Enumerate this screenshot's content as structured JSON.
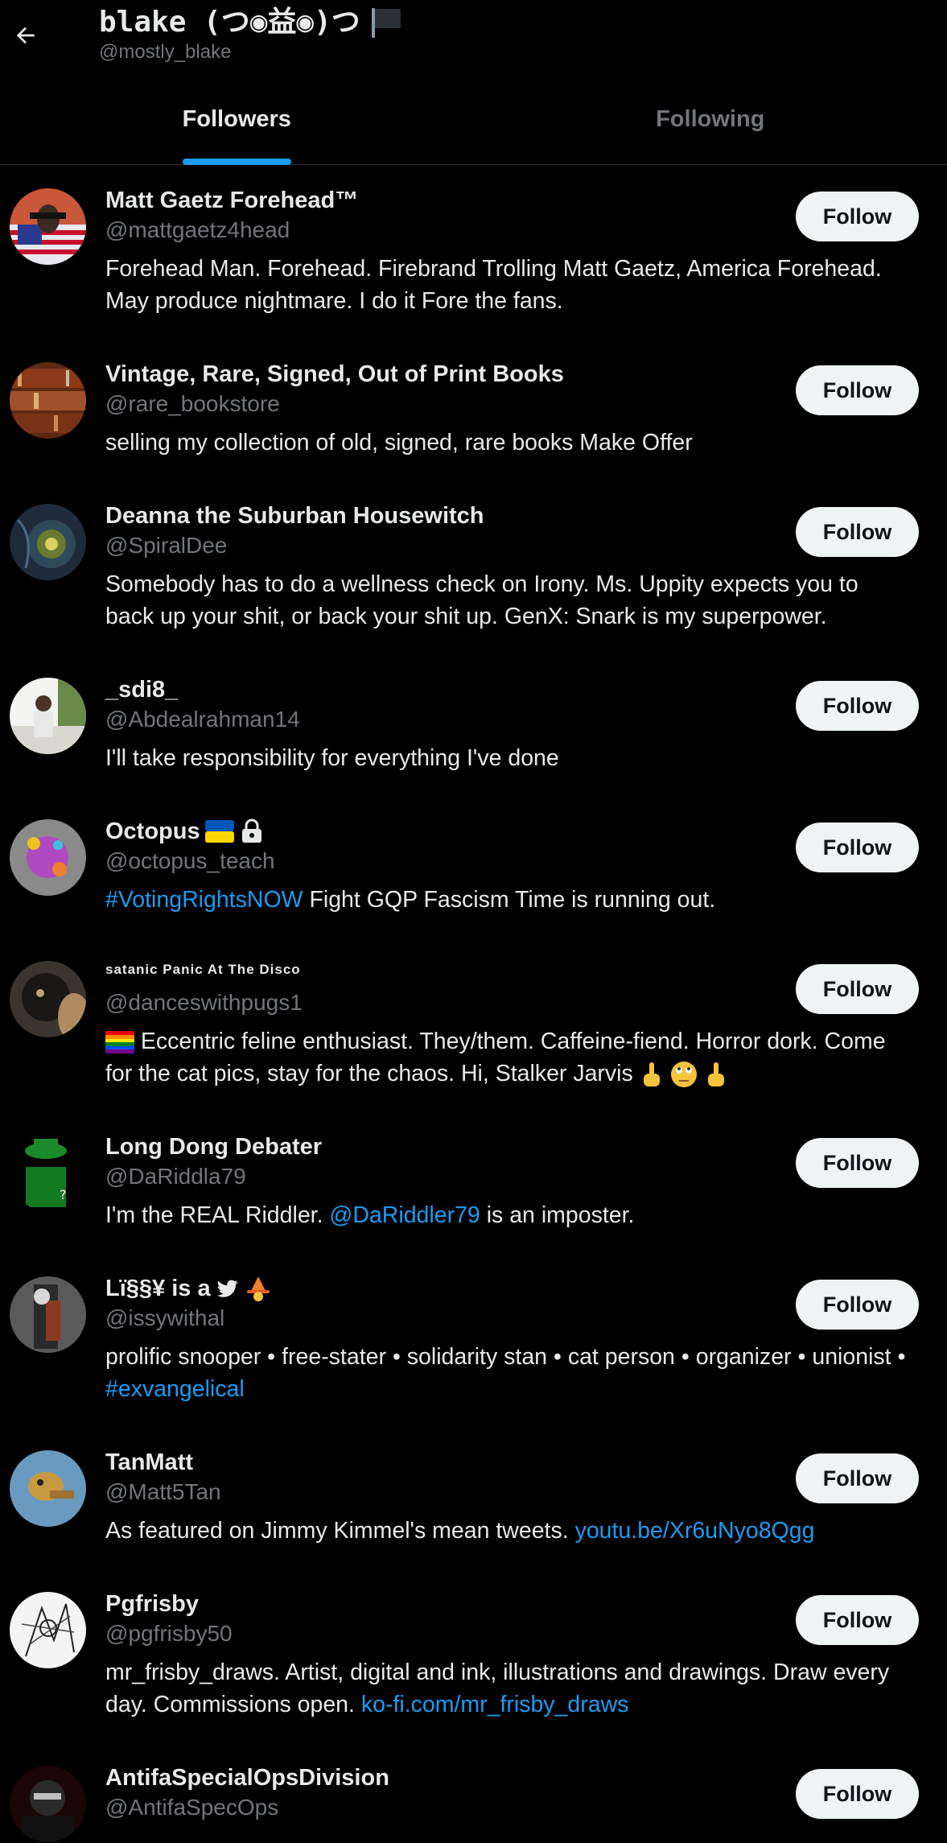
{
  "header": {
    "title": "blake (つ◉益◉)つ",
    "handle": "@mostly_blake"
  },
  "tabs": [
    {
      "label": "Followers",
      "active": true
    },
    {
      "label": "Following",
      "active": false
    }
  ],
  "follow_label": "Follow",
  "colors": {
    "background": "#000000",
    "accent": "#1d9bf0",
    "secondary_text": "#71767b",
    "button_bg": "#eff3f4"
  },
  "users": [
    {
      "name": "Matt Gaetz Forehead™",
      "handle": "@mattgaetz4head",
      "bio": [
        {
          "text": "Forehead Man. Forehead. Firebrand Trolling Matt Gaetz, America Forehead. May produce nightmare. I do it Fore the fans."
        }
      ]
    },
    {
      "name": "Vintage, Rare, Signed, Out of Print Books",
      "handle": "@rare_bookstore",
      "bio": [
        {
          "text": "selling my collection of old, signed, rare books Make Offer"
        }
      ]
    },
    {
      "name": "Deanna the Suburban Housewitch",
      "handle": "@SpiralDee",
      "bio": [
        {
          "text": "Somebody has to do a wellness check on Irony. Ms. Uppity expects you to back up your shit, or back your shit up. GenX: Snark is my superpower."
        }
      ]
    },
    {
      "name": "_sdi8_",
      "handle": "@Abdealrahman14",
      "bio": [
        {
          "text": "I'll take responsibility for everything I've done"
        }
      ]
    },
    {
      "name": "Octopus",
      "handle": "@octopus_teach",
      "bio": [
        {
          "text": "#VotingRightsNOW",
          "link": true
        },
        {
          "text": " Fight GQP Fascism Time is running out."
        }
      ]
    },
    {
      "name": "satanic Panic At The Disco",
      "handle": "@danceswithpugs1",
      "bio": [
        {
          "text": "Eccentric feline enthusiast. They/them. Caffeine-fiend. Horror dork. Come for the cat pics, stay for the chaos. Hi, Stalker Jarvis"
        }
      ]
    },
    {
      "name": "Long Dong Debater",
      "handle": "@DaRiddla79",
      "bio": [
        {
          "text": "I'm the REAL Riddler. "
        },
        {
          "text": "@DaRiddler79",
          "link": true
        },
        {
          "text": " is an imposter."
        }
      ]
    },
    {
      "name": "Lï§§¥ is a",
      "handle": "@issywithal",
      "bio": [
        {
          "text": "prolific snooper • free-stater • solidarity stan • cat person • organizer • unionist • "
        },
        {
          "text": "#exvangelical",
          "link": true
        }
      ]
    },
    {
      "name": "TanMatt",
      "handle": "@Matt5Tan",
      "bio": [
        {
          "text": "As featured on Jimmy Kimmel's mean tweets. "
        },
        {
          "text": "youtu.be/Xr6uNyo8Qgg",
          "link": true
        }
      ]
    },
    {
      "name": "Pgfrisby",
      "handle": "@pgfrisby50",
      "bio": [
        {
          "text": "mr_frisby_draws. Artist, digital and ink, illustrations and drawings. Draw every day. Commissions open. "
        },
        {
          "text": "ko-fi.com/mr_frisby_draws",
          "link": true
        }
      ]
    },
    {
      "name": "AntifaSpecialOpsDivision",
      "handle": "@AntifaSpecOps",
      "bio": []
    }
  ]
}
